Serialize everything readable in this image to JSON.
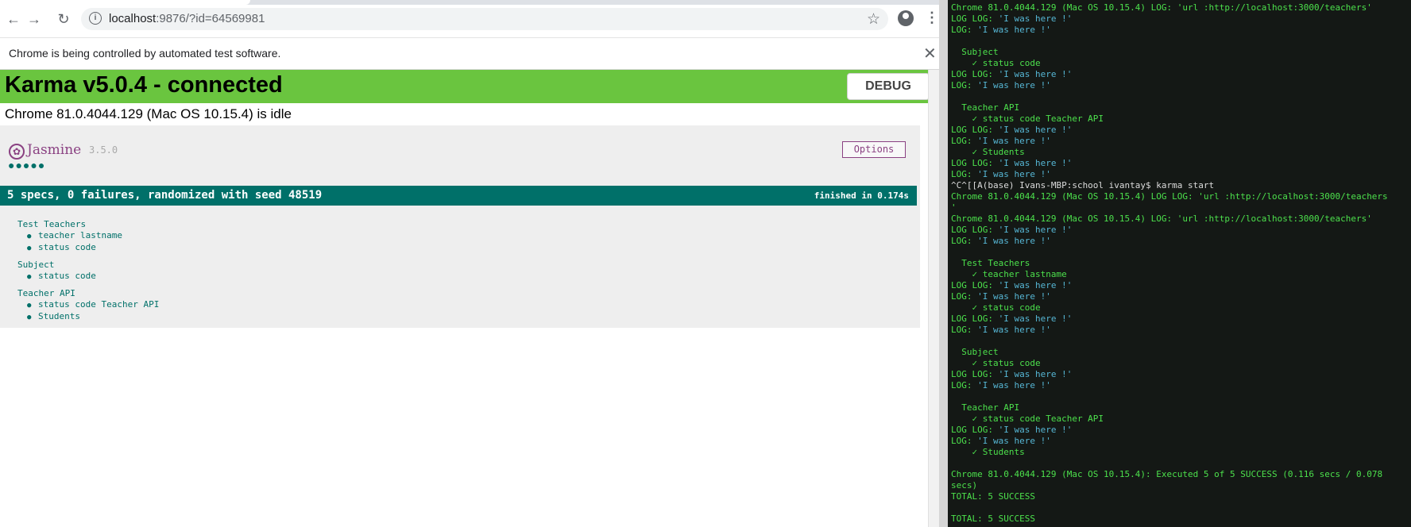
{
  "browser": {
    "url_host": "localhost",
    "url_path": ":9876/?id=64569981",
    "infobar_message": "Chrome is being controlled by automated test software.",
    "back_icon": "←",
    "forward_icon": "→",
    "reload_icon": "↻",
    "star_icon": "☆",
    "menu_icon": "⋮",
    "close_icon": "✕"
  },
  "karma": {
    "title": "Karma v5.0.4 - connected",
    "debug_label": "DEBUG",
    "status": "Chrome 81.0.4044.129 (Mac OS 10.15.4) is idle",
    "banner_color": "#6ac53f"
  },
  "jasmine": {
    "brand": "Jasmine",
    "version": "3.5.0",
    "options_label": "Options",
    "dots": "●●●●●",
    "summary": "5 specs, 0 failures, randomized with seed 48519",
    "duration": "finished in 0.174s",
    "accent_color": "#007069",
    "suites": [
      {
        "name": "Test Teachers",
        "specs": [
          "teacher lastname",
          "status code"
        ]
      },
      {
        "name": "Subject",
        "specs": [
          "status code"
        ]
      },
      {
        "name": "Teacher API",
        "specs": [
          "status code Teacher API",
          "Students"
        ]
      }
    ]
  },
  "terminal": {
    "lines": [
      [
        {
          "t": "Chrome 81.0.4044.129 (Mac OS 10.15.4) LOG: ",
          "c": "green"
        },
        {
          "t": "'url :http://localhost:3000/teachers'",
          "c": "green"
        }
      ],
      [
        {
          "t": "LOG LOG: ",
          "c": "green"
        },
        {
          "t": "'I was here !'",
          "c": "cyan"
        }
      ],
      [
        {
          "t": "LOG: ",
          "c": "green"
        },
        {
          "t": "'I was here !'",
          "c": "cyan"
        }
      ],
      [],
      [
        {
          "t": "  Subject",
          "c": "green"
        }
      ],
      [
        {
          "t": "    ✓ status code",
          "c": "green"
        }
      ],
      [
        {
          "t": "LOG LOG: ",
          "c": "green"
        },
        {
          "t": "'I was here !'",
          "c": "cyan"
        }
      ],
      [
        {
          "t": "LOG: ",
          "c": "green"
        },
        {
          "t": "'I was here !'",
          "c": "cyan"
        }
      ],
      [],
      [
        {
          "t": "  Teacher API",
          "c": "green"
        }
      ],
      [
        {
          "t": "    ✓ status code Teacher API",
          "c": "green"
        }
      ],
      [
        {
          "t": "LOG LOG: ",
          "c": "green"
        },
        {
          "t": "'I was here !'",
          "c": "cyan"
        }
      ],
      [
        {
          "t": "LOG: ",
          "c": "green"
        },
        {
          "t": "'I was here !'",
          "c": "cyan"
        }
      ],
      [
        {
          "t": "    ✓ Students",
          "c": "green"
        }
      ],
      [
        {
          "t": "LOG LOG: ",
          "c": "green"
        },
        {
          "t": "'I was here !'",
          "c": "cyan"
        }
      ],
      [
        {
          "t": "LOG: ",
          "c": "green"
        },
        {
          "t": "'I was here !'",
          "c": "cyan"
        }
      ],
      [
        {
          "t": "^C^[[A(base) Ivans-MBP:school ivantay$ karma start",
          "c": "white"
        }
      ],
      [
        {
          "t": "Chrome 81.0.4044.129 (Mac OS 10.15.4) LOG LOG: ",
          "c": "green"
        },
        {
          "t": "'url :http://localhost:3000/teachers",
          "c": "green"
        }
      ],
      [
        {
          "t": "'",
          "c": "green"
        }
      ],
      [
        {
          "t": "Chrome 81.0.4044.129 (Mac OS 10.15.4) LOG: ",
          "c": "green"
        },
        {
          "t": "'url :http://localhost:3000/teachers'",
          "c": "green"
        }
      ],
      [
        {
          "t": "LOG LOG: ",
          "c": "green"
        },
        {
          "t": "'I was here !'",
          "c": "cyan"
        }
      ],
      [
        {
          "t": "LOG: ",
          "c": "green"
        },
        {
          "t": "'I was here !'",
          "c": "cyan"
        }
      ],
      [],
      [
        {
          "t": "  Test Teachers",
          "c": "green"
        }
      ],
      [
        {
          "t": "    ✓ teacher lastname",
          "c": "green"
        }
      ],
      [
        {
          "t": "LOG LOG: ",
          "c": "green"
        },
        {
          "t": "'I was here !'",
          "c": "cyan"
        }
      ],
      [
        {
          "t": "LOG: ",
          "c": "green"
        },
        {
          "t": "'I was here !'",
          "c": "cyan"
        }
      ],
      [
        {
          "t": "    ✓ status code",
          "c": "green"
        }
      ],
      [
        {
          "t": "LOG LOG: ",
          "c": "green"
        },
        {
          "t": "'I was here !'",
          "c": "cyan"
        }
      ],
      [
        {
          "t": "LOG: ",
          "c": "green"
        },
        {
          "t": "'I was here !'",
          "c": "cyan"
        }
      ],
      [],
      [
        {
          "t": "  Subject",
          "c": "green"
        }
      ],
      [
        {
          "t": "    ✓ status code",
          "c": "green"
        }
      ],
      [
        {
          "t": "LOG LOG: ",
          "c": "green"
        },
        {
          "t": "'I was here !'",
          "c": "cyan"
        }
      ],
      [
        {
          "t": "LOG: ",
          "c": "green"
        },
        {
          "t": "'I was here !'",
          "c": "cyan"
        }
      ],
      [],
      [
        {
          "t": "  Teacher API",
          "c": "green"
        }
      ],
      [
        {
          "t": "    ✓ status code Teacher API",
          "c": "green"
        }
      ],
      [
        {
          "t": "LOG LOG: ",
          "c": "green"
        },
        {
          "t": "'I was here !'",
          "c": "cyan"
        }
      ],
      [
        {
          "t": "LOG: ",
          "c": "green"
        },
        {
          "t": "'I was here !'",
          "c": "cyan"
        }
      ],
      [
        {
          "t": "    ✓ Students",
          "c": "green"
        }
      ],
      [],
      [
        {
          "t": "Chrome 81.0.4044.129 (Mac OS 10.15.4): Executed 5 of 5 ",
          "c": "green"
        },
        {
          "t": "SUCCESS",
          "c": "green"
        },
        {
          "t": " (0.116 secs / 0.078",
          "c": "green"
        }
      ],
      [
        {
          "t": "secs)",
          "c": "green"
        }
      ],
      [
        {
          "t": "TOTAL: 5 SUCCESS",
          "c": "green"
        }
      ],
      [],
      [
        {
          "t": "TOTAL: 5 SUCCESS",
          "c": "green"
        }
      ]
    ]
  }
}
